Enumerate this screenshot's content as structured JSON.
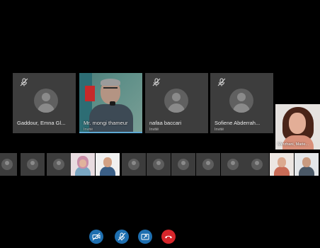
{
  "participants": [
    {
      "id": "gaddour",
      "name": "Gaddour, Emna Gl...",
      "role": "",
      "muted": true,
      "video": false
    },
    {
      "id": "mongi",
      "name": "Mr. mongi thameur",
      "role": "Invité",
      "muted": false,
      "video": true
    },
    {
      "id": "nafaa",
      "name": "nafaa baccari",
      "role": "Invité",
      "muted": true,
      "video": false
    },
    {
      "id": "sofiene",
      "name": "Sofiene Abderrah...",
      "role": "Invité",
      "muted": true,
      "video": false
    }
  ],
  "spotlight": {
    "name": "Merzhani, Marie..."
  },
  "thumbnails": [
    "avatar",
    "avatar",
    "avatar",
    "photo-woman-hijab",
    "photo-man",
    "avatar",
    "avatar",
    "avatar",
    "avatar",
    "avatar",
    "avatar",
    "avatar",
    "avatar",
    "photo-woman",
    "photo-man-2",
    "avatar"
  ],
  "controls": [
    {
      "id": "video-off",
      "icon": "video-off-icon"
    },
    {
      "id": "mic-off",
      "icon": "mic-off-icon"
    },
    {
      "id": "share",
      "icon": "share-screen-icon"
    },
    {
      "id": "hangup",
      "icon": "hang-up-icon"
    }
  ],
  "colors": {
    "tile": "#3d3d3d",
    "accent": "#1e6fb0",
    "hangup": "#d7262b"
  }
}
